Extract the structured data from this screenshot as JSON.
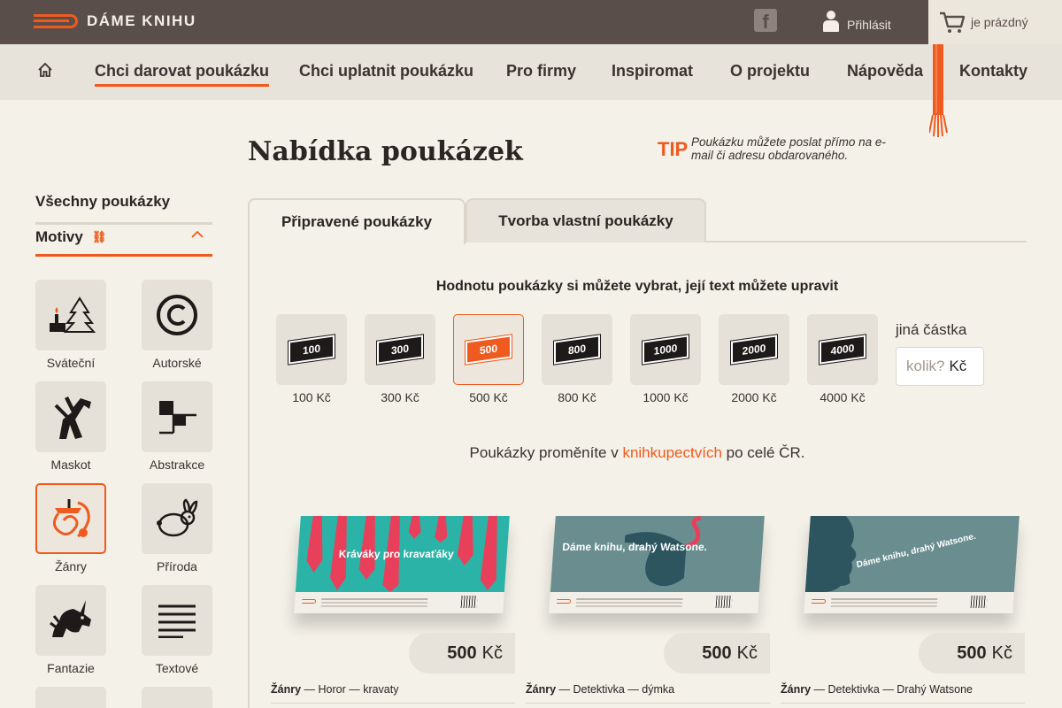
{
  "header": {
    "logo_text": "DÁME KNIHU",
    "facebook_icon": "facebook-icon",
    "login_label": "Přihlásit",
    "cart_label": "je prázdný"
  },
  "nav": {
    "items": [
      {
        "label": "Chci darovat poukázku",
        "active": true
      },
      {
        "label": "Chci uplatnit poukázku"
      },
      {
        "label": "Pro firmy"
      },
      {
        "label": "Inspiromat"
      },
      {
        "label": "O projektu"
      },
      {
        "label": "Nápověda"
      },
      {
        "label": "Kontakty"
      }
    ]
  },
  "sidebar": {
    "all_label": "Všechny poukázky",
    "motivy_label": "Motivy",
    "themes": [
      {
        "label": "Sváteční",
        "icon": "christmas-icon"
      },
      {
        "label": "Autorské",
        "icon": "copyright-icon"
      },
      {
        "label": "Maskot",
        "icon": "mascot-icon"
      },
      {
        "label": "Abstrakce",
        "icon": "abstraction-icon"
      },
      {
        "label": "Žánry",
        "icon": "genres-icon",
        "selected": true
      },
      {
        "label": "Příroda",
        "icon": "rabbit-icon"
      },
      {
        "label": "Fantazie",
        "icon": "unicorn-icon"
      },
      {
        "label": "Textové",
        "icon": "text-lines-icon"
      }
    ]
  },
  "main": {
    "title": "Nabídka poukázek",
    "tip_label": "TIP",
    "tip_text": "Poukázku můžete poslat přímo na e-mail či adresu obdarovaného.",
    "tabs": [
      {
        "label": "Připravené poukázky",
        "active": true
      },
      {
        "label": "Tvorba vlastní poukázky"
      }
    ],
    "value_heading": "Hodnotu poukázky si můžete vybrat, její text můžete upravit",
    "values": [
      {
        "flag": "100",
        "label": "100 Kč"
      },
      {
        "flag": "300",
        "label": "300 Kč"
      },
      {
        "flag": "500",
        "label": "500 Kč",
        "selected": true
      },
      {
        "flag": "800",
        "label": "800 Kč"
      },
      {
        "flag": "1000",
        "label": "1000 Kč"
      },
      {
        "flag": "2000",
        "label": "2000 Kč"
      },
      {
        "flag": "4000",
        "label": "4000 Kč"
      }
    ],
    "other_amount_label": "jiná částka",
    "other_amount_placeholder": "kolik?",
    "other_amount_unit": "Kč",
    "redeem_prefix": "Poukázky proměníte v ",
    "redeem_link": "knihkupectvích",
    "redeem_suffix": " po celé ČR.",
    "cards": [
      {
        "voucher_text": "Kráváky pro kravaťáky",
        "price_value": "500",
        "price_unit": "Kč",
        "genre": "Žánry",
        "tags": " — Horor — kravaty",
        "bg": "#2bb3a8"
      },
      {
        "voucher_text": "Dáme knihu, drahý Watsone.",
        "price_value": "500",
        "price_unit": "Kč",
        "genre": "Žánry",
        "tags": " — Detektivka — dýmka",
        "bg": "#6a8e8f"
      },
      {
        "voucher_text": "Dáme knihu, drahý Watsone.",
        "price_value": "500",
        "price_unit": "Kč",
        "genre": "Žánry",
        "tags": " — Detektivka — Drahý Watsone",
        "bg": "#6a8e8f"
      }
    ]
  },
  "colors": {
    "accent": "#ef5a1e",
    "topbar": "#5a4e4a",
    "background": "#f4f1e8"
  }
}
